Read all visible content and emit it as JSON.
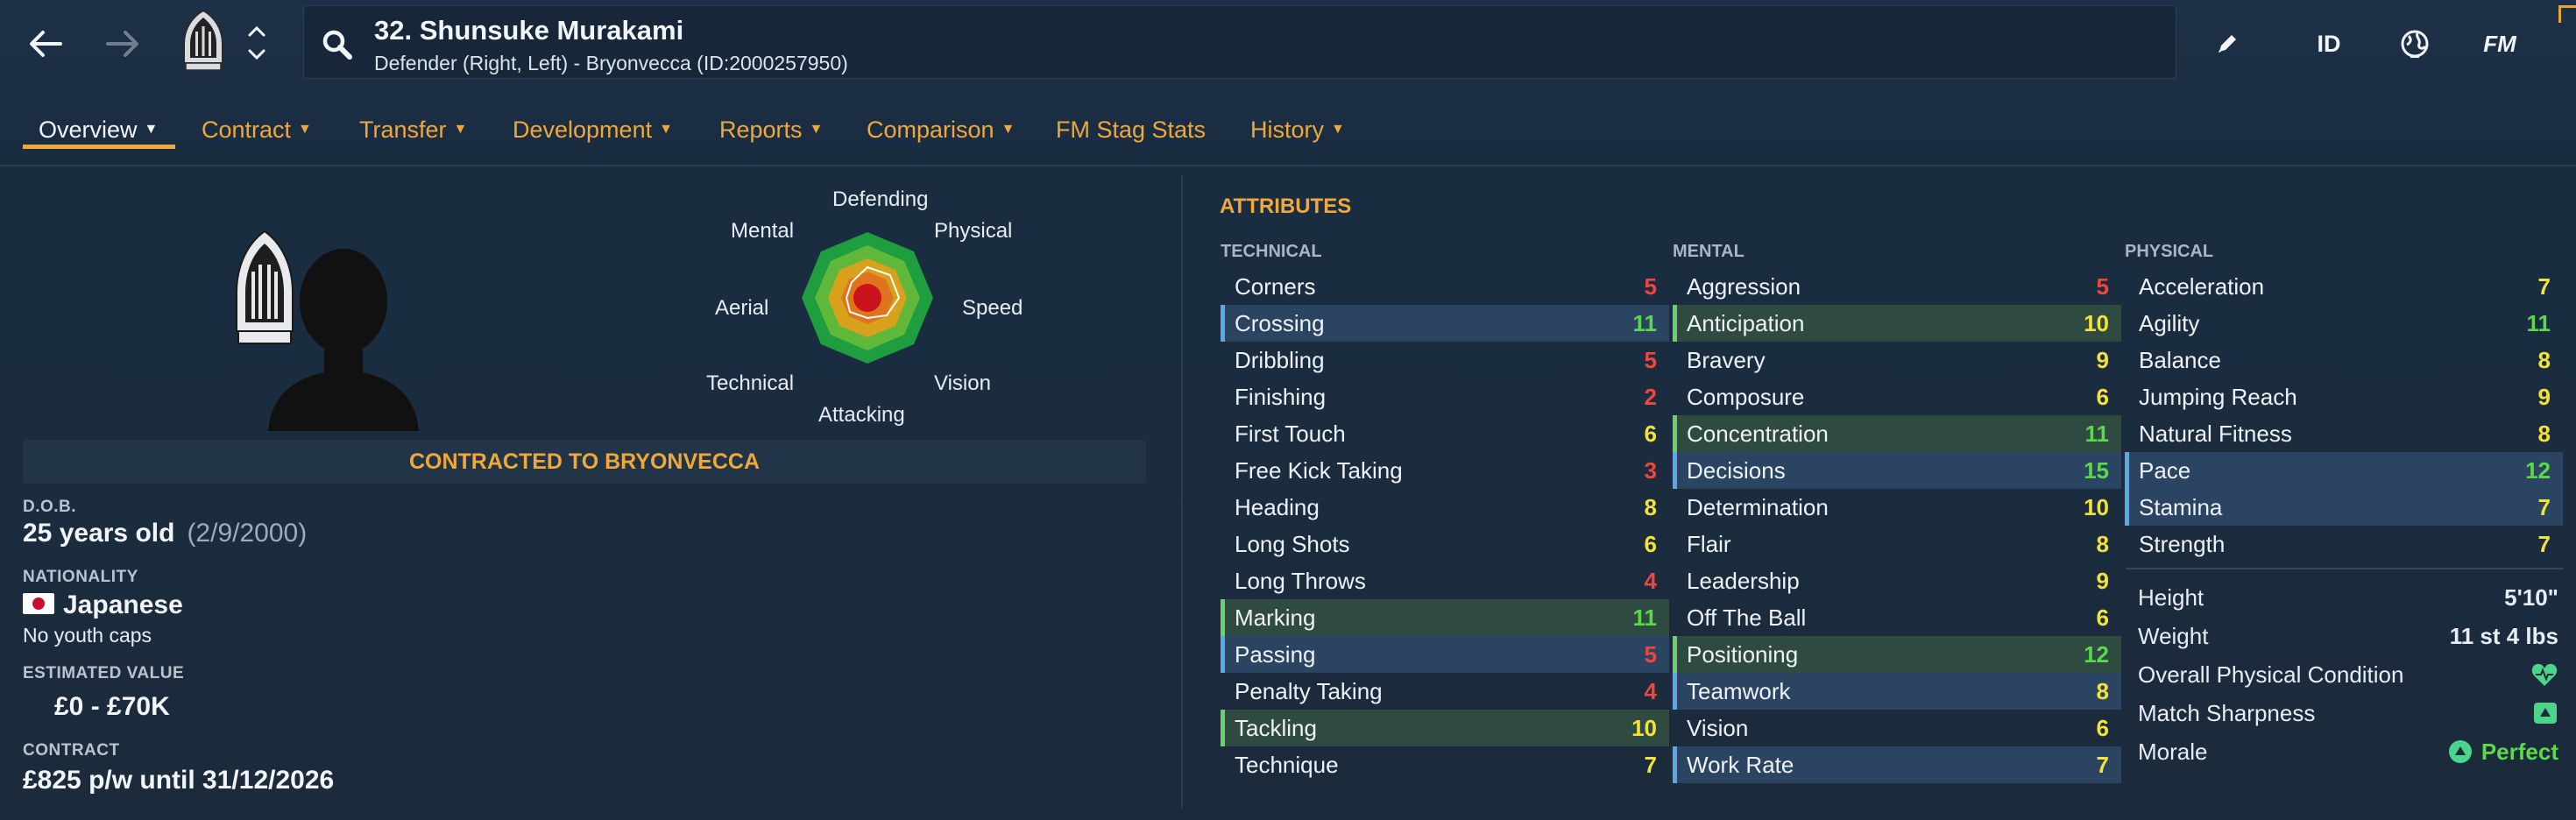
{
  "header": {
    "player_title": "32. Shunsuke Murakami",
    "player_subtitle": "Defender (Right, Left) - Bryonvecca (ID:2000257950)",
    "right_icons": {
      "id_label": "ID",
      "fm_label": "FM"
    }
  },
  "tabs": [
    {
      "label": "Overview",
      "has_dropdown": true,
      "active": true
    },
    {
      "label": "Contract",
      "has_dropdown": true
    },
    {
      "label": "Transfer",
      "has_dropdown": true
    },
    {
      "label": "Development",
      "has_dropdown": true
    },
    {
      "label": "Reports",
      "has_dropdown": true
    },
    {
      "label": "Comparison",
      "has_dropdown": true
    },
    {
      "label": "FM Stag Stats",
      "has_dropdown": false
    },
    {
      "label": "History",
      "has_dropdown": true
    }
  ],
  "radar": {
    "labels": {
      "defending": "Defending",
      "physical": "Physical",
      "speed": "Speed",
      "vision": "Vision",
      "attacking": "Attacking",
      "technical": "Technical",
      "aerial": "Aerial",
      "mental": "Mental"
    }
  },
  "overview": {
    "contract_banner": "CONTRACTED TO BRYONVECCA",
    "dob_label": "D.O.B.",
    "dob_value": "25 years old",
    "dob_date": "(2/9/2000)",
    "nationality_label": "NATIONALITY",
    "nationality_value": "Japanese",
    "youth_caps": "No youth caps",
    "value_label": "ESTIMATED VALUE",
    "value_value": "£0 - £70K",
    "contract_label": "CONTRACT",
    "contract_value": "£825 p/w until 31/12/2026"
  },
  "attributes": {
    "title": "ATTRIBUTES",
    "technical": {
      "heading": "TECHNICAL",
      "rows": [
        {
          "name": "Corners",
          "value": "5"
        },
        {
          "name": "Crossing",
          "value": "11"
        },
        {
          "name": "Dribbling",
          "value": "5"
        },
        {
          "name": "Finishing",
          "value": "2"
        },
        {
          "name": "First Touch",
          "value": "6"
        },
        {
          "name": "Free Kick Taking",
          "value": "3"
        },
        {
          "name": "Heading",
          "value": "8"
        },
        {
          "name": "Long Shots",
          "value": "6"
        },
        {
          "name": "Long Throws",
          "value": "4"
        },
        {
          "name": "Marking",
          "value": "11"
        },
        {
          "name": "Passing",
          "value": "5"
        },
        {
          "name": "Penalty Taking",
          "value": "4"
        },
        {
          "name": "Tackling",
          "value": "10"
        },
        {
          "name": "Technique",
          "value": "7"
        }
      ]
    },
    "mental": {
      "heading": "MENTAL",
      "rows": [
        {
          "name": "Aggression",
          "value": "5"
        },
        {
          "name": "Anticipation",
          "value": "10"
        },
        {
          "name": "Bravery",
          "value": "9"
        },
        {
          "name": "Composure",
          "value": "6"
        },
        {
          "name": "Concentration",
          "value": "11"
        },
        {
          "name": "Decisions",
          "value": "15"
        },
        {
          "name": "Determination",
          "value": "10"
        },
        {
          "name": "Flair",
          "value": "8"
        },
        {
          "name": "Leadership",
          "value": "9"
        },
        {
          "name": "Off The Ball",
          "value": "6"
        },
        {
          "name": "Positioning",
          "value": "12"
        },
        {
          "name": "Teamwork",
          "value": "8"
        },
        {
          "name": "Vision",
          "value": "6"
        },
        {
          "name": "Work Rate",
          "value": "7"
        }
      ]
    },
    "physical": {
      "heading": "PHYSICAL",
      "rows": [
        {
          "name": "Acceleration",
          "value": "7"
        },
        {
          "name": "Agility",
          "value": "11"
        },
        {
          "name": "Balance",
          "value": "8"
        },
        {
          "name": "Jumping Reach",
          "value": "9"
        },
        {
          "name": "Natural Fitness",
          "value": "8"
        },
        {
          "name": "Pace",
          "value": "12"
        },
        {
          "name": "Stamina",
          "value": "7"
        },
        {
          "name": "Strength",
          "value": "7"
        }
      ]
    }
  },
  "physical_info": {
    "height_label": "Height",
    "height_value": "5'10\"",
    "weight_label": "Weight",
    "weight_value": "11 st 4 lbs",
    "condition_label": "Overall Physical Condition",
    "sharpness_label": "Match Sharpness",
    "morale_label": "Morale",
    "morale_value": "Perfect"
  },
  "colors": {
    "accent": "#f0a83a",
    "value_red": "#f0463c",
    "value_yellow": "#f2e23a",
    "value_green": "#5bd94b",
    "highlight_green": "#2f4a41",
    "highlight_blue": "#2b4461"
  },
  "icons": [
    "back-arrow-icon",
    "forward-arrow-icon",
    "club-badge-icon",
    "chevron-up-icon",
    "chevron-down-icon",
    "search-icon",
    "edit-pencil-icon",
    "globe-icon",
    "heart-icon",
    "sharpness-icon",
    "morale-icon"
  ]
}
